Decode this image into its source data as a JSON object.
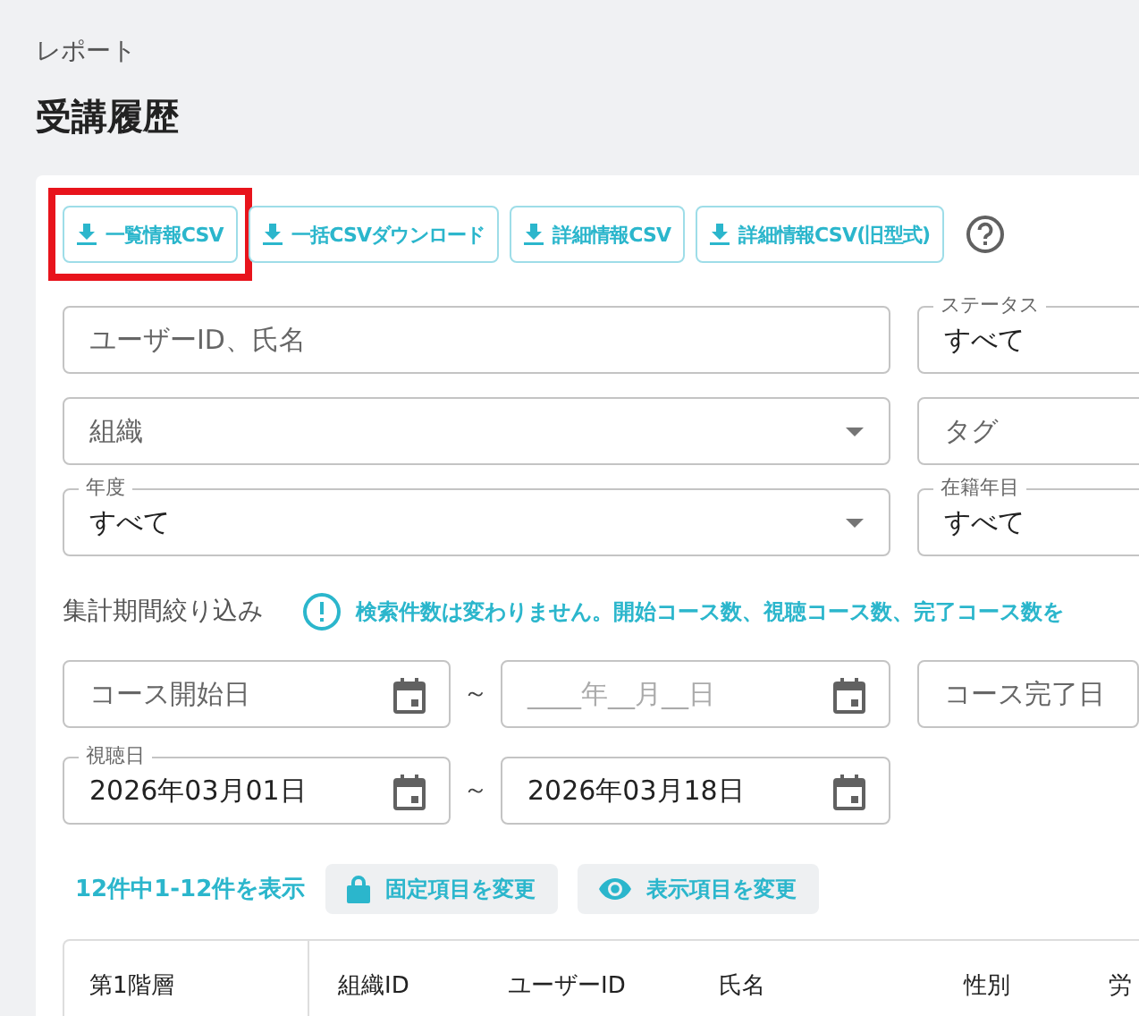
{
  "breadcrumb": "レポート",
  "title": "受講履歴",
  "export_buttons": [
    {
      "label": "一覧情報CSV",
      "highlighted": true
    },
    {
      "label": "一括CSVダウンロード",
      "highlighted": false
    },
    {
      "label": "詳細情報CSV",
      "highlighted": false
    },
    {
      "label": "詳細情報CSV(旧型式)",
      "highlighted": false
    }
  ],
  "filter_rows": [
    [
      {
        "kind": "text",
        "placeholder": "ユーザーID、氏名"
      },
      {
        "kind": "plain",
        "label": "ステータス",
        "value": "すべて"
      }
    ],
    [
      {
        "kind": "select",
        "placeholder": "組織"
      },
      {
        "kind": "plain",
        "placeholder": "タグ"
      }
    ],
    [
      {
        "kind": "select",
        "label": "年度",
        "value": "すべて"
      },
      {
        "kind": "plain",
        "label": "在籍年目",
        "value": "すべて"
      }
    ]
  ],
  "period": {
    "label": "集計期間絞り込み",
    "notice": "検索件数は変わりません。開始コース数、視聴コース数、完了コース数を"
  },
  "date_rows": [
    {
      "from": {
        "kind": "date",
        "placeholder": "コース開始日"
      },
      "separator": "～",
      "to": {
        "kind": "date-mask",
        "placeholder": "____年__月__日"
      },
      "extra": {
        "kind": "plain",
        "placeholder": "コース完了日"
      }
    },
    {
      "from": {
        "kind": "date",
        "label": "視聴日",
        "value": "2026年03月01日"
      },
      "separator": "～",
      "to": {
        "kind": "date",
        "value": "2026年03月18日"
      }
    }
  ],
  "result_count": "12件中1-12件を表示",
  "toolbar_buttons": [
    {
      "kind": "lock",
      "label": "固定項目を変更"
    },
    {
      "kind": "eye",
      "label": "表示項目を変更"
    }
  ],
  "table": {
    "fixed_columns": [
      "第1階層"
    ],
    "columns": [
      "組織ID",
      "ユーザーID",
      "氏名",
      "性別",
      "労"
    ]
  }
}
